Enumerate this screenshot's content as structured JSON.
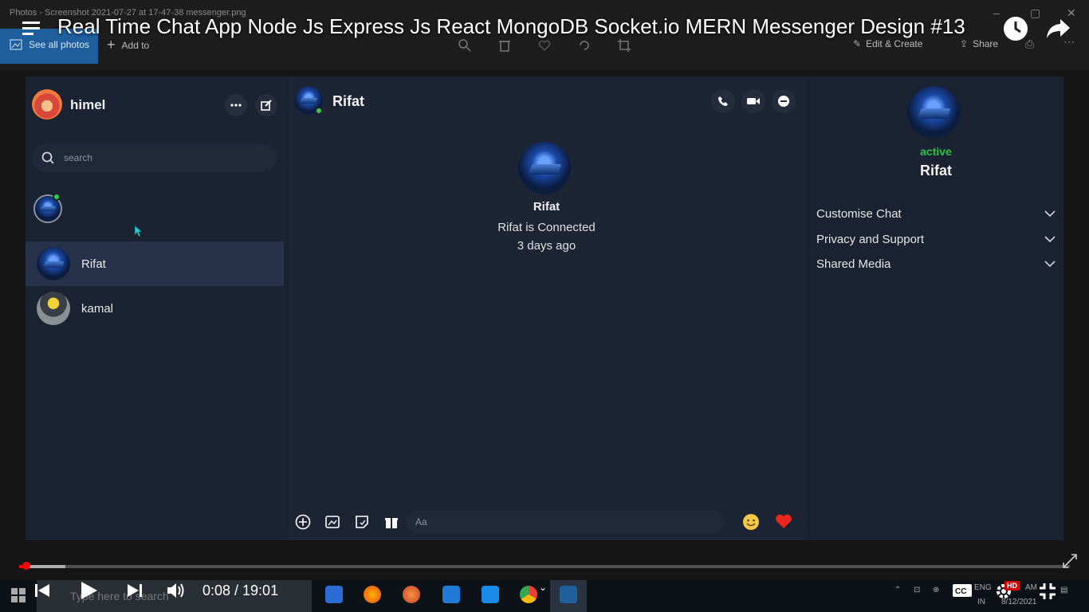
{
  "photos_app": {
    "title": "Photos - Screenshot 2021-07-27 at 17-47-38 messenger.png",
    "see_all": "See all photos",
    "add_to": "Add to",
    "edit_create": "Edit & Create",
    "share": "Share"
  },
  "video": {
    "title": "Real Time Chat App Node Js Express Js React MongoDB Socket.io MERN Messenger Design #13",
    "time": "0:08 / 19:01",
    "hd_badge": "HD",
    "progress_fraction": 0.007,
    "buffered_fraction": 0.044
  },
  "taskbar": {
    "search_placeholder": "Type here to search",
    "lang_top": "ENG",
    "lang_bottom": "IN",
    "clock_top": "AM",
    "clock_bottom": "8/12/2021"
  },
  "messenger": {
    "me": {
      "name": "himel"
    },
    "search_placeholder": "search",
    "friends": [
      {
        "name": "Rifat",
        "selected": true
      },
      {
        "name": "kamal",
        "selected": false
      }
    ],
    "chat": {
      "name": "Rifat",
      "intro_name": "Rifat",
      "connected_text": "Rifat is Connected",
      "ago_text": "3 days ago",
      "input_placeholder": "Aa"
    },
    "profile": {
      "status": "active",
      "name": "Rifat",
      "options": [
        "Customise Chat",
        "Privacy and Support",
        "Shared Media"
      ]
    }
  },
  "colors": {
    "accent_active": "#2ec24a",
    "app_bg": "#1b2231",
    "selected_row": "#27314a",
    "progress": "#ff0000"
  }
}
